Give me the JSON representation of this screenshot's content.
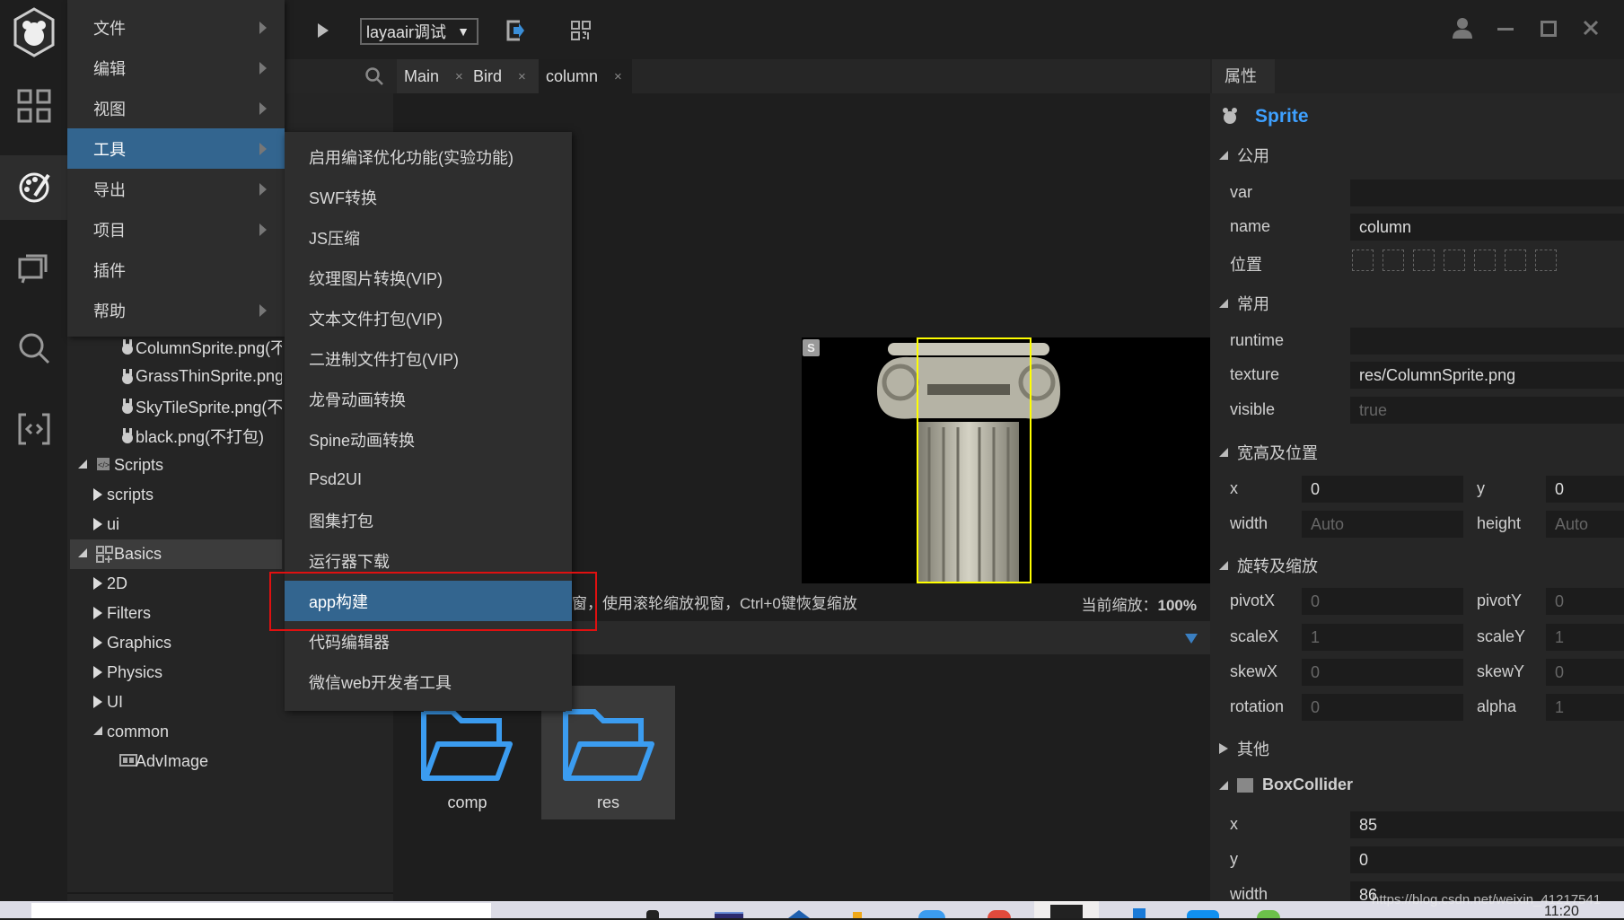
{
  "toolbar": {
    "run_config": "layaair调试",
    "dropdown_arrow": "▼"
  },
  "main_menu": [
    {
      "label": "文件",
      "submenu": true
    },
    {
      "label": "编辑",
      "submenu": true
    },
    {
      "label": "视图",
      "submenu": true
    },
    {
      "label": "工具",
      "submenu": true,
      "selected": true
    },
    {
      "label": "导出",
      "submenu": true
    },
    {
      "label": "项目",
      "submenu": true
    },
    {
      "label": "插件",
      "submenu": false
    },
    {
      "label": "帮助",
      "submenu": true
    }
  ],
  "tools_submenu": [
    "启用编译优化功能(实验功能)",
    "SWF转换",
    "JS压缩",
    "纹理图片转换(VIP)",
    "文本文件打包(VIP)",
    "二进制文件打包(VIP)",
    "龙骨动画转换",
    "Spine动画转换",
    "Psd2UI",
    "图集打包",
    "运行器下载",
    "app构建",
    "代码编辑器",
    "微信web开发者工具"
  ],
  "tools_submenu_selected": "app构建",
  "tabs": [
    {
      "label": "Main",
      "close": "×"
    },
    {
      "label": "Bird",
      "close": "×"
    },
    {
      "label": "column",
      "close": "×"
    }
  ],
  "tree": [
    {
      "label": "ColumnSprite.png(不",
      "icon": "sprite-icon"
    },
    {
      "label": "GrassThinSprite.png",
      "icon": "sprite-icon"
    },
    {
      "label": "SkyTileSprite.png(不",
      "icon": "sprite-icon"
    },
    {
      "label": "black.png(不打包)",
      "icon": "sprite-icon"
    },
    {
      "label": "Scripts",
      "icon": "scripts-icon",
      "expanded": true
    },
    {
      "label": "scripts",
      "expanded": false
    },
    {
      "label": "ui",
      "expanded": false
    },
    {
      "label": "Basics",
      "icon": "basics-icon",
      "expanded": true,
      "selected": true
    },
    {
      "label": "2D",
      "expanded": false
    },
    {
      "label": "Filters",
      "expanded": false
    },
    {
      "label": "Graphics",
      "expanded": false
    },
    {
      "label": "Physics",
      "expanded": false
    },
    {
      "label": "UI",
      "expanded": false
    },
    {
      "label": "common",
      "expanded": true
    },
    {
      "label": "AdvImage",
      "icon": "image-icon"
    }
  ],
  "scene": {
    "badge": "S",
    "hint": "窗，使用滚轮缩放视窗，Ctrl+0键恢复缩放",
    "zoom_label": "当前缩放：",
    "zoom_value": "100%"
  },
  "resources": [
    {
      "label": "comp"
    },
    {
      "label": "res",
      "selected": true
    }
  ],
  "props": {
    "tab": "属性",
    "component": "Sprite",
    "sections": {
      "common": "公用",
      "usual": "常用",
      "size": "宽高及位置",
      "transform": "旋转及缩放",
      "other": "其他"
    },
    "var": {
      "label": "var",
      "value": ""
    },
    "name": {
      "label": "name",
      "value": "column"
    },
    "position_label": "位置",
    "runtime": {
      "label": "runtime",
      "value": ""
    },
    "texture": {
      "label": "texture",
      "value": "res/ColumnSprite.png"
    },
    "visible": {
      "label": "visible",
      "value": "true"
    },
    "x": {
      "label": "x",
      "value": "0"
    },
    "y": {
      "label": "y",
      "value": "0"
    },
    "width": {
      "label": "width",
      "value": "Auto"
    },
    "height": {
      "label": "height",
      "value": "Auto"
    },
    "pivotX": {
      "label": "pivotX",
      "value": "0"
    },
    "pivotY": {
      "label": "pivotY",
      "value": "0"
    },
    "scaleX": {
      "label": "scaleX",
      "value": "1"
    },
    "scaleY": {
      "label": "scaleY",
      "value": "1"
    },
    "skewX": {
      "label": "skewX",
      "value": "0"
    },
    "skewY": {
      "label": "skewY",
      "value": "0"
    },
    "rotation": {
      "label": "rotation",
      "value": "0"
    },
    "alpha": {
      "label": "alpha",
      "value": "1"
    },
    "collider": {
      "label": "BoxCollider",
      "enabled": true,
      "x": {
        "label": "x",
        "value": "85"
      },
      "y": {
        "label": "y",
        "value": "0"
      },
      "width": {
        "label": "width",
        "value": "86"
      }
    }
  },
  "taskbar": {
    "time": "11:20",
    "watermark": "https://blog.csdn.net/weixin_41217541"
  },
  "colors": {
    "accent": "#33658f",
    "highlight_box": "#e01010",
    "component_title": "#3ea0ff",
    "selection_rect": "#ffff00",
    "folder": "#3b9cf0"
  }
}
